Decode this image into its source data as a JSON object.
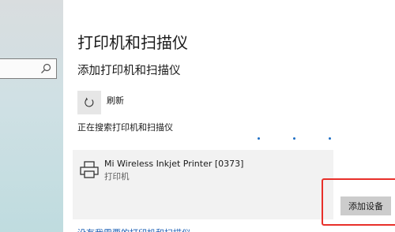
{
  "page": {
    "title": "打印机和扫描仪",
    "section_title": "添加打印机和扫描仪",
    "refresh_label": "刷新",
    "searching_text": "正在搜索打印机和扫描仪"
  },
  "device": {
    "name": "Mi Wireless Inkjet Printer [0373]",
    "type": "打印机",
    "action_label": "添加设备"
  },
  "bottom_link": "没有我需要的打印机和扫描仪",
  "colors": {
    "highlight": "#e8302a",
    "accent": "#1f6fc5"
  },
  "icons": {
    "search": "search-icon",
    "refresh": "refresh-icon",
    "printer": "printer-icon"
  }
}
